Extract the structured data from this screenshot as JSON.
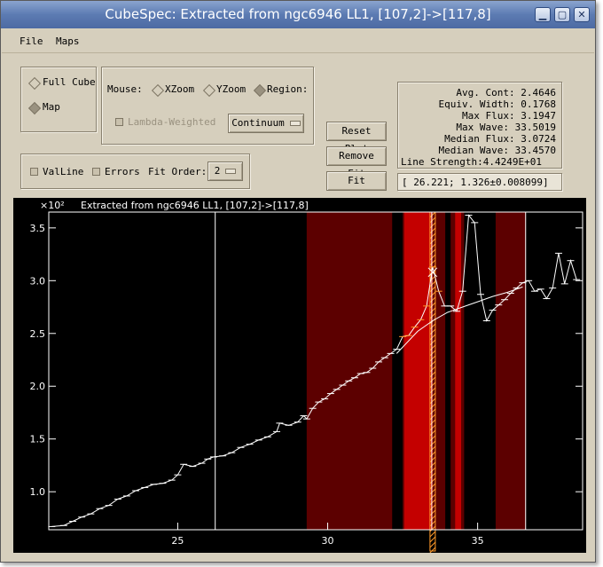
{
  "window": {
    "title": "CubeSpec: Extracted from ngc6946 LL1, [107,2]->[117,8]"
  },
  "menu": {
    "file": "File",
    "maps": "Maps"
  },
  "mode": {
    "full_cube": "Full Cube",
    "map": "Map",
    "selected": "Map"
  },
  "mouse": {
    "label": "Mouse:",
    "xzoom": "XZoom",
    "yzoom": "YZoom",
    "region": "Region:",
    "selected": "Region"
  },
  "lambda_weighted": "Lambda-Weighted",
  "continuum_dropdown": "Continuum",
  "valline": "ValLine",
  "errors": "Errors",
  "fit_order": {
    "label": "Fit Order:",
    "value": "2"
  },
  "buttons": {
    "reset_plot": "Reset Plot",
    "remove_fit": "Remove Fit",
    "fit": "Fit"
  },
  "stats": [
    "Avg. Cont:  2.4646",
    "Equiv. Width:  0.1768",
    "Max Flux:  3.1947",
    "Max Wave: 33.5019",
    "Median Flux:  3.0724",
    "Median Wave: 33.4570",
    "Line Strength:4.4249E+01"
  ],
  "readout": "[ 26.221;    1.326±0.008099]",
  "icons": {
    "minimize": "minimize-icon",
    "maximize": "maximize-icon",
    "close": "close-icon"
  },
  "chart_data": {
    "type": "line",
    "title": "Extracted from ngc6946 LL1, [107,2]->[117,8]",
    "y_multiplier_label": "×10²",
    "xlim": [
      20.7,
      38.5
    ],
    "ylim": [
      0.64,
      3.65
    ],
    "xticks": [
      25,
      30,
      35
    ],
    "yticks": [
      1.0,
      1.5,
      2.0,
      2.5,
      3.0,
      3.5
    ],
    "ytick_labels": [
      "1.0",
      "1.5",
      "2.0",
      "2.5",
      "3.0",
      "3.5"
    ],
    "colors": {
      "background": "#000000",
      "line": "#ffffff",
      "region_dark": "#5c0000",
      "region_bright": "#c40000",
      "highlight": "#ff9a2a"
    },
    "regions_dark": [
      [
        29.3,
        32.15
      ],
      [
        32.5,
        33.92
      ],
      [
        34.1,
        34.55
      ],
      [
        35.6,
        36.6
      ]
    ],
    "regions_bright": [
      [
        32.55,
        33.5
      ],
      [
        34.25,
        34.45
      ]
    ],
    "marker_lines": [
      26.25,
      33.47,
      36.6
    ],
    "hatched_line_at": 33.5,
    "series": [
      {
        "values": [
          [
            20.8,
            0.67
          ],
          [
            21.2,
            0.68
          ],
          [
            21.5,
            0.72
          ],
          [
            21.8,
            0.76
          ],
          [
            22.1,
            0.79
          ],
          [
            22.4,
            0.84
          ],
          [
            22.7,
            0.87
          ],
          [
            23.0,
            0.93
          ],
          [
            23.3,
            0.96
          ],
          [
            23.6,
            1.01
          ],
          [
            23.9,
            1.04
          ],
          [
            24.2,
            1.07
          ],
          [
            24.5,
            1.08
          ],
          [
            24.8,
            1.11
          ],
          [
            25.0,
            1.16
          ],
          [
            25.2,
            1.26
          ],
          [
            25.5,
            1.24
          ],
          [
            25.8,
            1.27
          ],
          [
            26.0,
            1.31
          ],
          [
            26.2,
            1.33
          ],
          [
            26.5,
            1.34
          ],
          [
            26.8,
            1.37
          ],
          [
            27.1,
            1.42
          ],
          [
            27.4,
            1.45
          ],
          [
            27.7,
            1.49
          ],
          [
            28.0,
            1.52
          ],
          [
            28.3,
            1.57
          ],
          [
            28.4,
            1.65
          ],
          [
            28.7,
            1.63
          ],
          [
            29.0,
            1.66
          ],
          [
            29.2,
            1.72
          ],
          [
            29.3,
            1.69
          ],
          [
            29.5,
            1.79
          ],
          [
            29.7,
            1.85
          ],
          [
            29.9,
            1.88
          ],
          [
            30.1,
            1.93
          ],
          [
            30.3,
            1.97
          ],
          [
            30.5,
            2.01
          ],
          [
            30.7,
            2.05
          ],
          [
            30.9,
            2.08
          ],
          [
            31.1,
            2.12
          ],
          [
            31.3,
            2.13
          ],
          [
            31.5,
            2.17
          ],
          [
            31.7,
            2.23
          ],
          [
            31.9,
            2.27
          ],
          [
            32.1,
            2.31
          ],
          [
            32.3,
            2.35
          ],
          [
            32.5,
            2.47
          ],
          [
            32.7,
            2.48
          ],
          [
            32.9,
            2.56
          ],
          [
            33.1,
            2.63
          ],
          [
            33.3,
            2.76
          ],
          [
            33.5,
            3.13
          ],
          [
            33.7,
            2.9
          ],
          [
            33.9,
            2.76
          ],
          [
            34.1,
            2.76
          ],
          [
            34.3,
            2.71
          ],
          [
            34.5,
            2.9
          ],
          [
            34.7,
            3.62
          ],
          [
            34.9,
            3.55
          ],
          [
            35.1,
            2.87
          ],
          [
            35.3,
            2.62
          ],
          [
            35.5,
            2.72
          ],
          [
            35.7,
            2.77
          ],
          [
            35.9,
            2.82
          ],
          [
            36.1,
            2.88
          ],
          [
            36.3,
            2.93
          ],
          [
            36.5,
            2.98
          ],
          [
            36.7,
            3.0
          ],
          [
            36.9,
            2.9
          ],
          [
            37.1,
            2.92
          ],
          [
            37.3,
            2.83
          ],
          [
            37.5,
            2.93
          ],
          [
            37.7,
            3.26
          ],
          [
            37.9,
            2.97
          ],
          [
            38.1,
            3.19
          ],
          [
            38.3,
            3.01
          ]
        ]
      },
      {
        "values": [
          [
            32.3,
            2.31
          ],
          [
            33.0,
            2.52
          ],
          [
            33.5,
            2.62
          ],
          [
            34.0,
            2.7
          ],
          [
            34.5,
            2.75
          ],
          [
            35.0,
            2.8
          ],
          [
            35.5,
            2.85
          ],
          [
            36.0,
            2.89
          ],
          [
            36.5,
            2.94
          ]
        ]
      }
    ]
  }
}
